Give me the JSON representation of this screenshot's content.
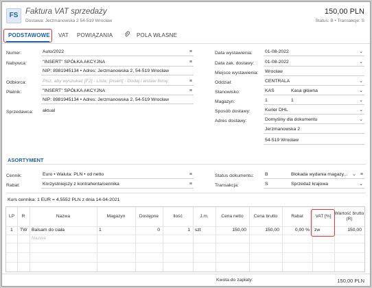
{
  "header": {
    "badge": "FS",
    "title": "Faktura VAT sprzedaży",
    "subtitle": "Dostawa: Jerzmanowska 2 54-519 Wrocław",
    "amount": "150,00 PLN",
    "status": "Status: B  •  Transakcje: S"
  },
  "tabs": [
    "PODSTAWOWE",
    "VAT",
    "POWIĄZANIA",
    "POLA WŁASNE"
  ],
  "left": {
    "numer_label": "Numer:",
    "numer": "Auto/2022",
    "nabywca_label": "Nabywca:",
    "nabywca": "\"INSERT\" SPÓŁKA AKCYJNA",
    "nabywca_nip": "NIP: 8981945134  •  Adres: Jerzmanowska 2, 54-519 Wrocław",
    "odbiorca_label": "Odbiorca:",
    "odbiorca_placeholder": "Pisz, aby wyszukać [F2] - Lista; [Insert] - Dodaj i wstaw firmę;",
    "platnik_label": "Płatnik:",
    "platnik": "\"INSERT\" SPÓŁKA AKCYJNA",
    "platnik_nip": "NIP: 8981945134  •  Adres: Jerzmanowska 2, 54-519 Wrocław",
    "sprzedawca_label": "Sprzedawca:",
    "sprzedawca": "aktual"
  },
  "right": {
    "data_wyst_label": "Data wystawienia:",
    "data_wyst": "01-08-2022",
    "data_dost_label": "Data zak. dostawy:",
    "data_dost": "01-08-2022",
    "miejsce_label": "Miejsce wystawienia:",
    "miejsce": "Wrocław",
    "oddzial_label": "Oddział:",
    "oddzial": "CENTRALA",
    "stanowisko_label": "Stanowisko:",
    "stanowisko_code": "KAS",
    "stanowisko": "Kasa główna",
    "magazyn_label": "Magazyn:",
    "magazyn_code": "1",
    "magazyn": "1",
    "sposob_label": "Sposób dostawy:",
    "sposob": "Kurier DHL",
    "adres_label": "Adres dostawy:",
    "adres": "Domyślny dla dokumentu",
    "adres_line1": "Jerzmanowska 2",
    "adres_line2": "54-519 Wrocław"
  },
  "asortyment": {
    "title": "ASORTYMENT",
    "cennik_label": "Cennik:",
    "cennik": "Euro • Waluta: PLN • od netto",
    "rabat_label": "Rabat:",
    "rabat": "Korzystniejszy z kontrahenta/cennika",
    "status_label": "Status dokumentu:",
    "status_code": "B",
    "status": "Blokada wydania magazy...",
    "transakcja_label": "Transakcja:",
    "transakcja_code": "S",
    "transakcja": "Sprzedaż krajowa",
    "kurs": "Kurs cennika: 1 EUR = 4,5552 PLN z dnia 14-04-2021"
  },
  "grid": {
    "headers": [
      "LP",
      "R",
      "Nazwa",
      "Magazyn",
      "Dostępne",
      "Ilość",
      "J.m.",
      "Cena netto",
      "Cena brutto",
      "Rabat",
      "VAT [%]",
      "Wartość brutto (R)"
    ],
    "row": {
      "lp": "1",
      "r": "TW",
      "nazwa": "Balsam do ciała",
      "magazyn": "1",
      "dostepne": "0",
      "ilosc": "1",
      "jm": "szt",
      "cena_netto": "150,00",
      "cena_brutto": "150,00",
      "rabat": "0,00 %",
      "vat": "zw",
      "wartosc": "150,00"
    },
    "new_placeholder": "Nazwa"
  },
  "footer": {
    "label": "Kwota do zapłaty:",
    "value": "150,00 PLN"
  }
}
